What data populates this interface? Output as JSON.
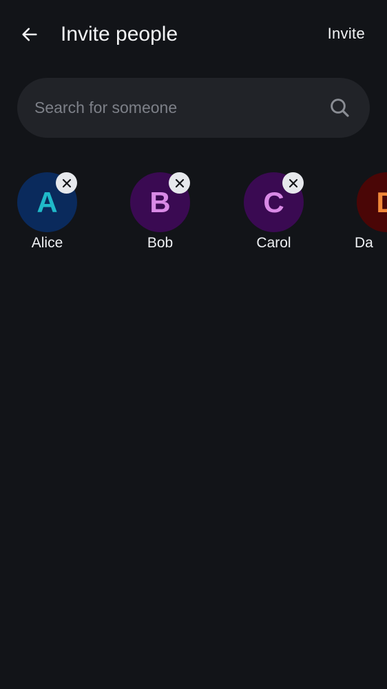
{
  "header": {
    "title": "Invite people",
    "invite_label": "Invite",
    "back_icon": "arrow-left-icon"
  },
  "search": {
    "placeholder": "Search for someone",
    "value": "",
    "icon": "search-icon"
  },
  "selected_people": [
    {
      "initial": "A",
      "name": "Alice",
      "avatar_bg": "#0a2a5c",
      "initial_color": "#20b9c9",
      "removable": true
    },
    {
      "initial": "B",
      "name": "Bob",
      "avatar_bg": "#3a0a52",
      "initial_color": "#d98ae6",
      "removable": true
    },
    {
      "initial": "C",
      "name": "Carol",
      "avatar_bg": "#3a0a52",
      "initial_color": "#d98ae6",
      "removable": true
    },
    {
      "initial": "D",
      "name": "Da",
      "avatar_bg": "#4a0606",
      "initial_color": "#f0883a",
      "removable": false
    }
  ],
  "colors": {
    "background": "#121418",
    "search_bg": "#212328",
    "text_primary": "#f2f3f5",
    "text_placeholder": "#7d8088",
    "remove_button_bg": "#e6e8ec"
  }
}
